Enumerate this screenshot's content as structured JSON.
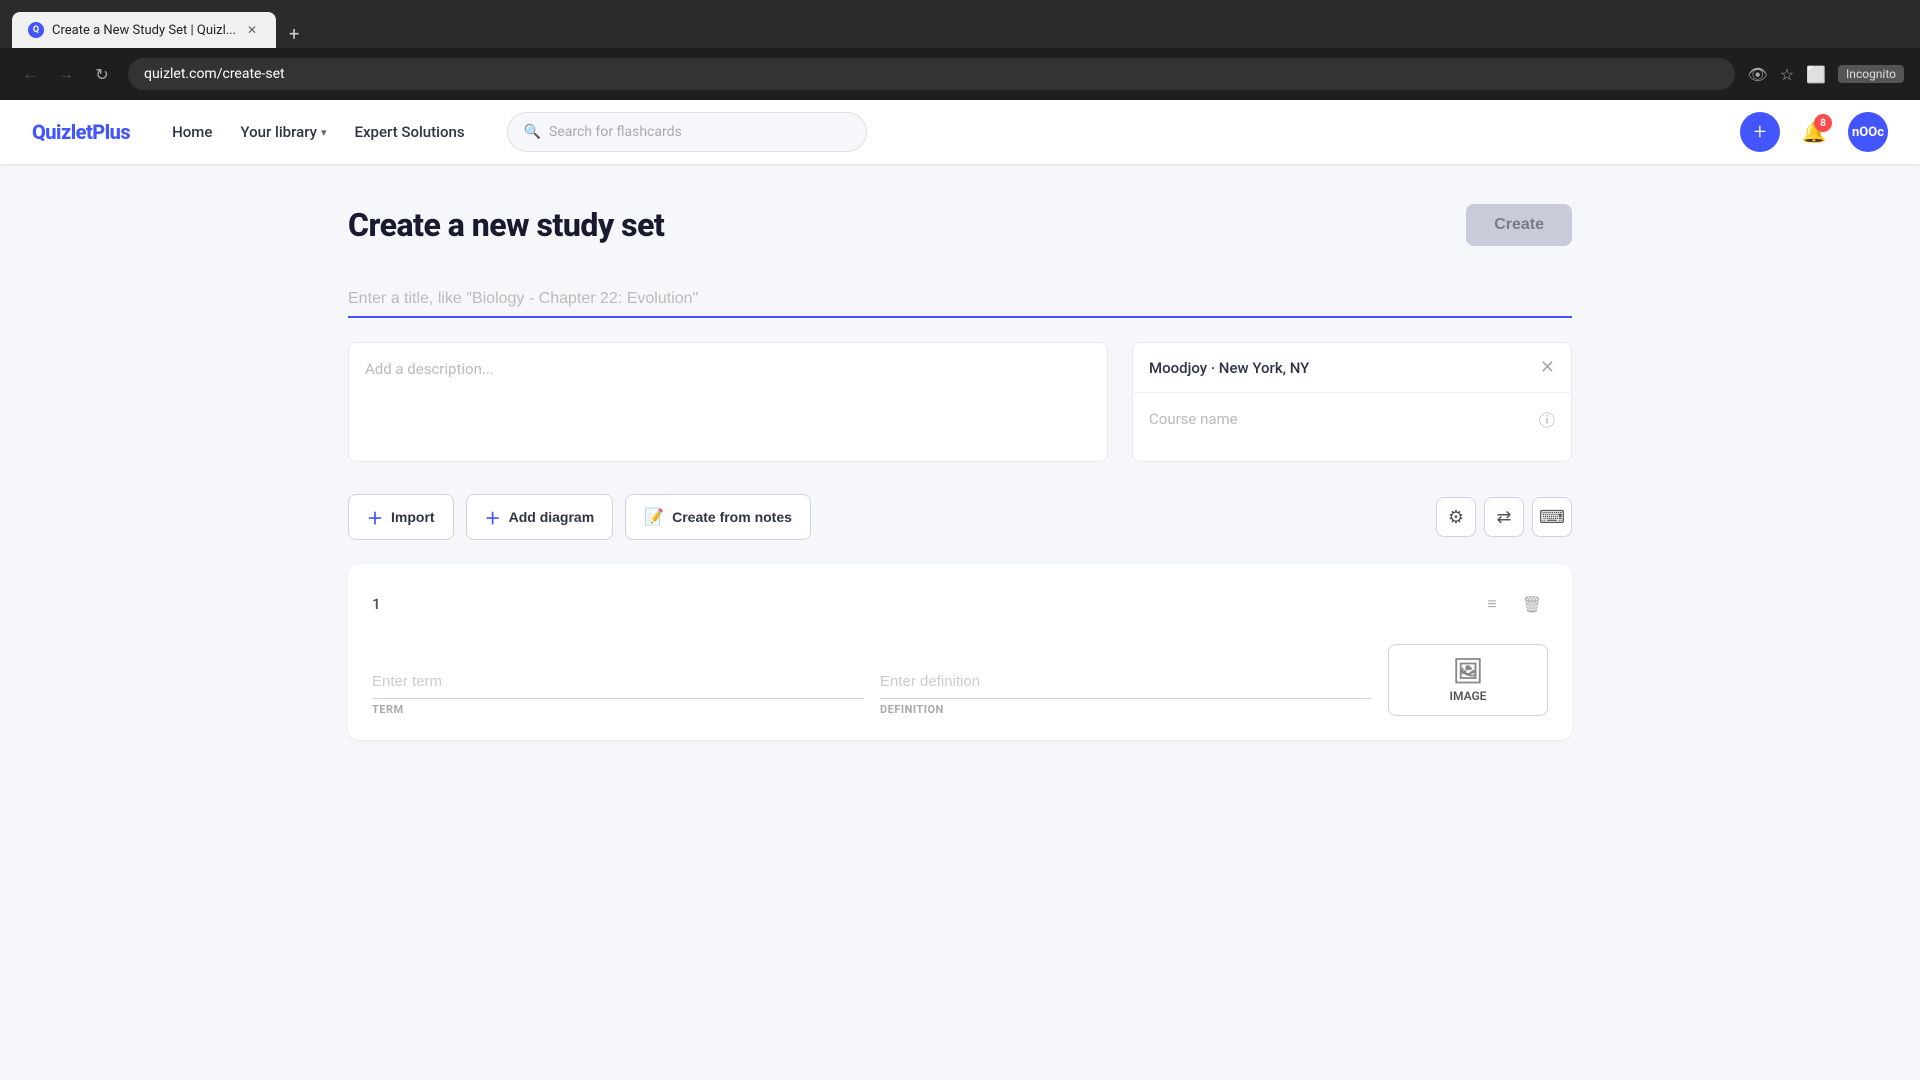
{
  "browser": {
    "tab_title": "Create a New Study Set | Quizl...",
    "new_tab_label": "+",
    "url": "quizlet.com/create-set",
    "favicon_letter": "Q",
    "incognito_label": "Incognito"
  },
  "nav": {
    "logo": "QuizletPlus",
    "home": "Home",
    "your_library": "Your library",
    "expert_solutions": "Expert Solutions",
    "search_placeholder": "Search for flashcards",
    "notification_count": "8",
    "avatar_text": "nOOc"
  },
  "page": {
    "title": "Create a new study set",
    "create_btn": "Create",
    "title_placeholder": "Enter a title, like \"Biology - Chapter 22: Evolution\"",
    "description_placeholder": "Add a description...",
    "school": {
      "name": "Moodjoy · New York, NY",
      "course_placeholder": "Course name"
    },
    "toolbar": {
      "import_label": "Import",
      "add_diagram_label": "Add diagram",
      "create_from_notes_label": "Create from notes"
    },
    "card": {
      "number": "1",
      "term_placeholder": "Enter term",
      "term_label": "TERM",
      "definition_placeholder": "Enter definition",
      "definition_label": "DEFINITION",
      "image_label": "IMAGE"
    }
  }
}
